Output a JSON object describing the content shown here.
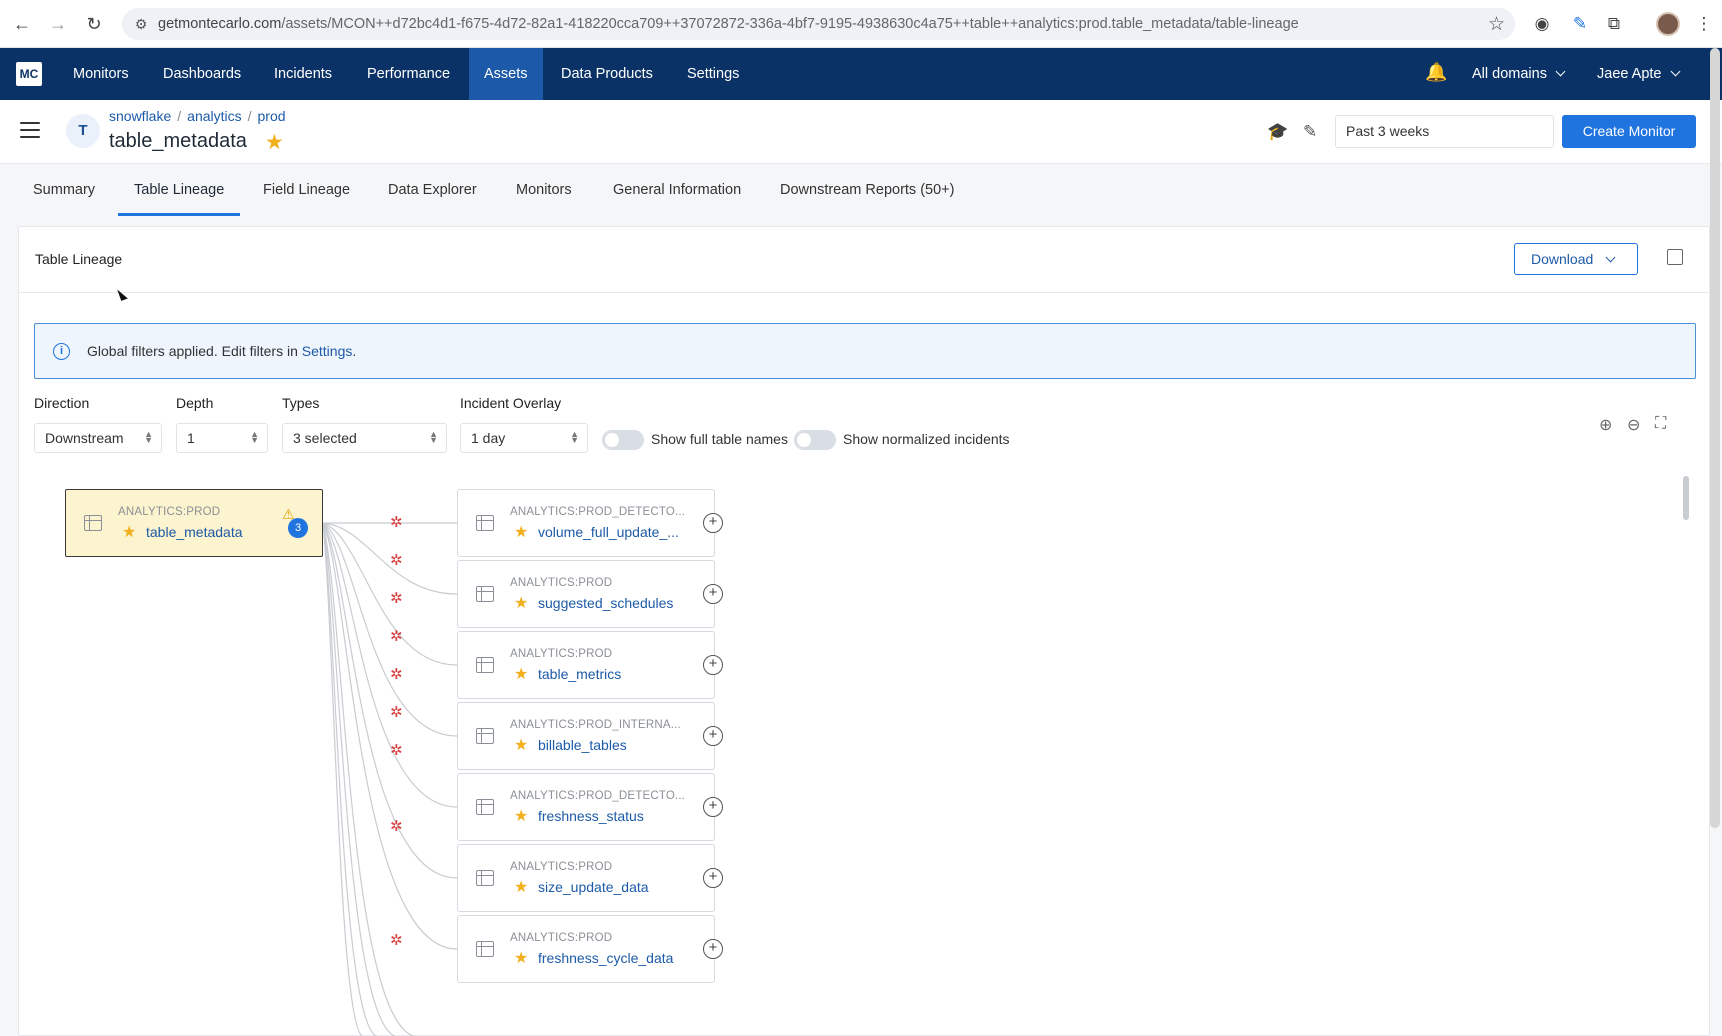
{
  "browser": {
    "url_host": "getmontecarlo.com",
    "url_path": "/assets/MCON++d72bc4d1-f675-4d72-82a1-418220cca709++37072872-336a-4bf7-9195-4938630c4a75++table++analytics:prod.table_metadata/table-lineage"
  },
  "nav": {
    "logo": "MC",
    "items": [
      "Monitors",
      "Dashboards",
      "Incidents",
      "Performance",
      "Assets",
      "Data Products",
      "Settings"
    ],
    "active": "Assets",
    "domains": "All domains",
    "user": "Jaee Apte"
  },
  "header": {
    "avatar": "T",
    "breadcrumb": [
      "snowflake",
      "analytics",
      "prod"
    ],
    "title": "table_metadata",
    "date_range": "Past 3 weeks",
    "create_button": "Create Monitor"
  },
  "tabs": [
    "Summary",
    "Table Lineage",
    "Field Lineage",
    "Data Explorer",
    "Monitors",
    "General Information",
    "Downstream Reports (50+)"
  ],
  "panel": {
    "title": "Table Lineage",
    "download": "Download",
    "banner_text": "Global filters applied. Edit filters in ",
    "banner_link": "Settings",
    "banner_end": "."
  },
  "filters": {
    "direction_label": "Direction",
    "direction_value": "Downstream",
    "depth_label": "Depth",
    "depth_value": "1",
    "types_label": "Types",
    "types_value": "3 selected",
    "overlay_label": "Incident Overlay",
    "overlay_value": "1 day",
    "toggle1": "Show full table names",
    "toggle2": "Show normalized incidents"
  },
  "graph": {
    "source": {
      "schema": "ANALYTICS:PROD",
      "name": "table_metadata",
      "incidents": "3"
    },
    "nodes": [
      {
        "schema": "ANALYTICS:PROD_DETECTO...",
        "name": "volume_full_update_..."
      },
      {
        "schema": "ANALYTICS:PROD",
        "name": "suggested_schedules"
      },
      {
        "schema": "ANALYTICS:PROD",
        "name": "table_metrics"
      },
      {
        "schema": "ANALYTICS:PROD_INTERNA...",
        "name": "billable_tables"
      },
      {
        "schema": "ANALYTICS:PROD_DETECTO...",
        "name": "freshness_status"
      },
      {
        "schema": "ANALYTICS:PROD",
        "name": "size_update_data"
      },
      {
        "schema": "ANALYTICS:PROD",
        "name": "freshness_cycle_data"
      }
    ]
  }
}
